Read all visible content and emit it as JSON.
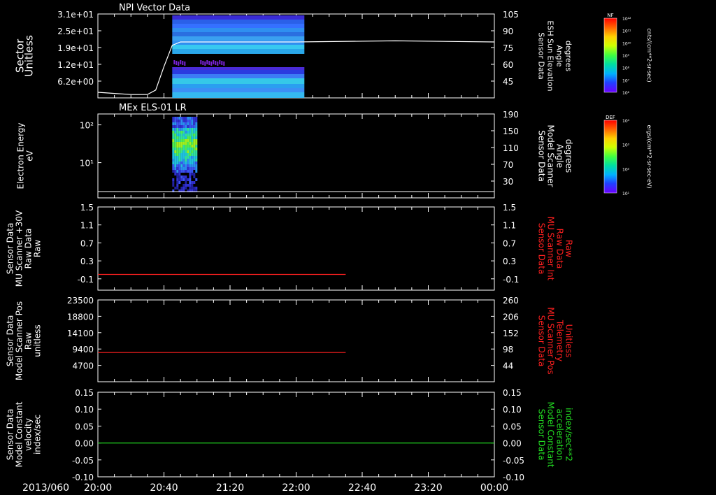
{
  "colors": {
    "background": "#000000",
    "axis": "#ffffff",
    "red": "#ff2020",
    "green": "#22dd22",
    "white": "#ffffff"
  },
  "panels": [
    {
      "title": "NPI Vector Data",
      "left_label": [
        "Sector",
        "Unitless"
      ],
      "right_label": [
        "Sensor Data",
        "ESH Sun Elevation",
        "Angle",
        "degrees"
      ],
      "right_color": "#ffffff"
    },
    {
      "title": "MEx ELS-01 LR",
      "left_label": [
        "Electron Energy",
        "eV"
      ],
      "right_label": [
        "Sensor Data",
        "Model Scanner",
        "Angle",
        "degrees"
      ],
      "right_color": "#ffffff"
    },
    {
      "title": "",
      "left_label": [
        "Sensor Data",
        "MU Scanner +30V",
        "Raw Data",
        "Raw"
      ],
      "right_label": [
        "Sensor Data",
        "MU Scanner Int",
        "Raw Data",
        "Raw"
      ],
      "right_color": "#ff2020"
    },
    {
      "title": "",
      "left_label": [
        "Sensor Data",
        "Model Scanner Pos",
        "Raw",
        "unitless"
      ],
      "right_label": [
        "Sensor Data",
        "MU Scanner Pos",
        "Telemetry",
        "Unitless"
      ],
      "right_color": "#ff2020"
    },
    {
      "title": "",
      "left_label": [
        "Sensor Data",
        "Model Constant",
        "velocity",
        "index/sec"
      ],
      "right_label": [
        "Sensor Data",
        "Model Constant",
        "acceleration",
        "index/sec**2"
      ],
      "right_color": "#22dd22"
    }
  ],
  "colorbars": [
    {
      "label": "NF",
      "unit": "cnts/(cm**2-sr-sec)",
      "ticks": [
        "10¹²",
        "10¹¹",
        "10¹⁰",
        "10⁹",
        "10⁸",
        "10⁷",
        "10⁶"
      ]
    },
    {
      "label": "DEF",
      "unit": "ergs/(cm**2-sr-sec-eV)",
      "ticks": [
        "10⁴",
        "10³",
        "10²",
        "10¹"
      ]
    }
  ],
  "time_axis": {
    "date_label": "2013/060",
    "ticks": [
      "20:00",
      "20:40",
      "21:20",
      "22:00",
      "22:40",
      "23:20",
      "00:00"
    ]
  },
  "chart_data": [
    {
      "type": "heatmap",
      "title": "NPI Vector Data",
      "ylabel": "Sector Unitless",
      "y_ticks": [
        "3.1e+01",
        "2.5e+01",
        "1.9e+01",
        "1.2e+01",
        "6.2e+00"
      ],
      "y2_label": "Sensor Data ESH Sun Elevation Angle degrees",
      "y2_ticks": [
        "105",
        "90",
        "75",
        "60",
        "45"
      ],
      "y2lim": [
        30,
        105
      ],
      "data_time_range": [
        "20:45",
        "22:05"
      ],
      "line_series": {
        "name": "ESH Sun Elevation",
        "x": [
          "20:00",
          "20:10",
          "20:20",
          "20:30",
          "20:35",
          "20:40",
          "20:45",
          "20:50",
          "21:00",
          "22:00",
          "23:00",
          "00:00"
        ],
        "y": [
          35,
          34,
          33,
          33,
          37,
          58,
          77,
          80,
          80,
          80,
          81,
          80
        ]
      }
    },
    {
      "type": "heatmap",
      "title": "MEx ELS-01 LR",
      "ylabel": "Electron Energy eV",
      "y_ticks": [
        "10²",
        "10¹"
      ],
      "y2_label": "Sensor Data Model Scanner Angle degrees",
      "y2_ticks": [
        "190",
        "150",
        "110",
        "70",
        "30"
      ],
      "y2lim": [
        0,
        190
      ],
      "data_time_range": [
        "20:45",
        "21:00"
      ],
      "line_series": {
        "name": "Model Scanner Angle",
        "x": [
          "20:00",
          "00:00"
        ],
        "y": [
          9,
          9
        ]
      }
    },
    {
      "type": "line",
      "ylabel": "Sensor Data MU Scanner +30V Raw Data Raw",
      "y_ticks": [
        "1.5",
        "1.1",
        "0.7",
        "0.3",
        "-0.1"
      ],
      "ylim": [
        -0.35,
        1.5
      ],
      "y2_label": "Sensor Data MU Scanner Int Raw Data Raw",
      "y2_ticks": [
        "1.5",
        "1.1",
        "0.7",
        "0.3",
        "-0.1"
      ],
      "series": [
        {
          "x": [
            "20:00",
            "22:30"
          ],
          "y": [
            0.0,
            0.0
          ]
        }
      ]
    },
    {
      "type": "line",
      "ylabel": "Sensor Data Model Scanner Pos Raw unitless",
      "y_ticks": [
        "23500",
        "18800",
        "14100",
        "9400",
        "4700"
      ],
      "ylim": [
        0,
        23500
      ],
      "y2_label": "Sensor Data MU Scanner Pos Telemetry Unitless",
      "y2_ticks": [
        "260",
        "206",
        "152",
        "98",
        "44"
      ],
      "series": [
        {
          "x": [
            "20:00",
            "22:30"
          ],
          "y": [
            8400,
            8400
          ]
        }
      ]
    },
    {
      "type": "line",
      "ylabel": "Sensor Data Model Constant velocity index/sec",
      "y_ticks": [
        "0.15",
        "0.10",
        "0.05",
        "0.00",
        "-0.05",
        "-0.10"
      ],
      "ylim": [
        -0.1,
        0.15
      ],
      "y2_label": "Sensor Data Model Constant acceleration index/sec**2",
      "y2_ticks": [
        "0.15",
        "0.10",
        "0.05",
        "0.00",
        "-0.05",
        "-0.10"
      ],
      "series": [
        {
          "x": [
            "20:00",
            "00:00"
          ],
          "y": [
            0.0,
            0.0
          ]
        }
      ]
    }
  ]
}
